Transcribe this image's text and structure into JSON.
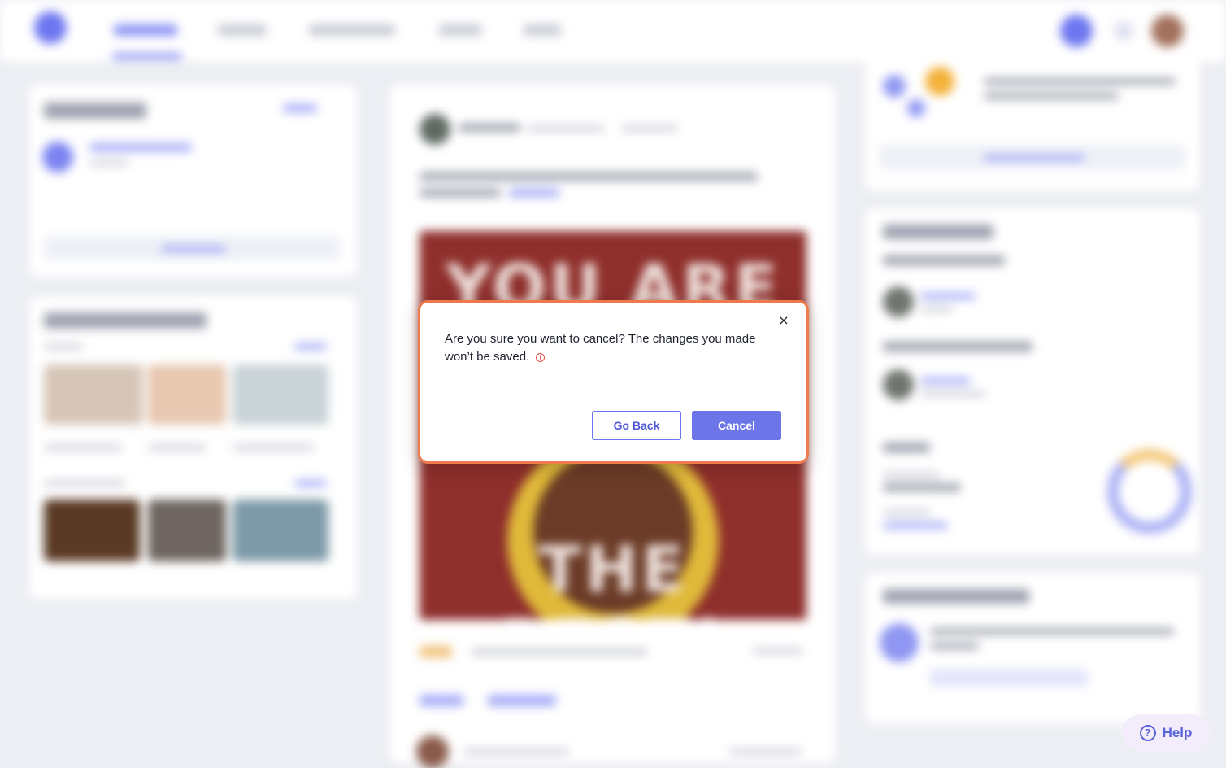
{
  "modal": {
    "message": "Are you sure you want to cancel? The changes you made won’t be saved.",
    "close_glyph": "×",
    "info_glyph": "i",
    "go_back_label": "Go Back",
    "cancel_label": "Cancel"
  },
  "background": {
    "poster_line1": "YOU ARE",
    "poster_line2": "THE BEST!"
  },
  "help": {
    "label": "Help",
    "icon_glyph": "?"
  },
  "colors": {
    "accent": "#6d76e9",
    "modal_border": "#ef7b4d",
    "info_red": "#e0524a",
    "poster_red": "#8f2f2c"
  }
}
